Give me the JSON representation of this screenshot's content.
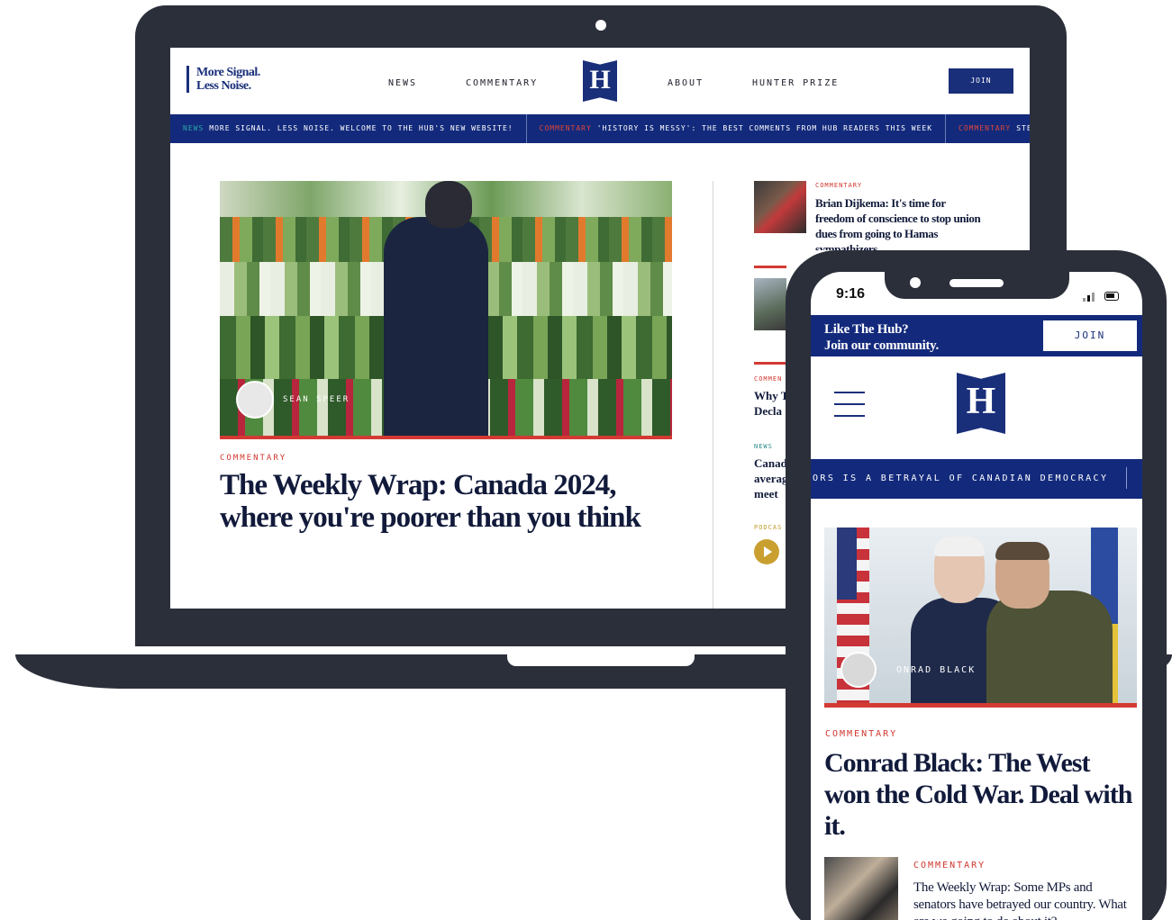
{
  "laptop": {
    "header": {
      "tagline_1": "More Signal.",
      "tagline_2": "Less Noise.",
      "nav": [
        "NEWS",
        "COMMENTARY",
        "ABOUT",
        "HUNTER PRIZE"
      ],
      "logo_letter": "H",
      "join_label": "JOIN"
    },
    "ticker": [
      {
        "tag": "NEWS",
        "text": "MORE SIGNAL. LESS NOISE. WELCOME TO THE HUB'S NEW WEBSITE!"
      },
      {
        "tag": "COMMENTARY",
        "text": "'HISTORY IS MESSY': THE BEST COMMENTS FROM HUB READERS THIS WEEK"
      },
      {
        "tag": "COMMENTARY",
        "text": "STEPHEN"
      }
    ],
    "hero": {
      "author": "SEAN SPEER",
      "category": "COMMENTARY",
      "headline": "The Weekly Wrap: Canada 2024, where you're poorer than you think"
    },
    "side": [
      {
        "category": "COMMENTARY",
        "headline": "Brian Dijkema: It's time for freedom of conscience to stop union dues from going to Hamas sympathizers"
      },
      {
        "category": "COMMEN",
        "headline_1": "Why T",
        "headline_2": "Decla"
      },
      {
        "category": "NEWS",
        "headline_1": "Canad",
        "headline_2": "averag",
        "headline_3": "meet"
      },
      {
        "category": "PODCAS"
      }
    ]
  },
  "phone": {
    "time": "9:16",
    "banner": {
      "line_1": "Like The Hub?",
      "line_2": "Join our community.",
      "join_label": "JOIN"
    },
    "logo_letter": "H",
    "ticker_text": "ORS IS A BETRAYAL OF CANADIAN DEMOCRACY",
    "hero": {
      "author": "ONRAD BLACK",
      "category": "COMMENTARY",
      "headline": "Conrad Black: The West won the Cold War. Deal with it."
    },
    "second": {
      "category": "COMMENTARY",
      "headline": "The Weekly Wrap: Some MPs and senators have betrayed our country. What are we going to do about it?"
    }
  },
  "colors": {
    "navy": "#1a2f7a",
    "red": "#d0352d",
    "device": "#2b2f3a"
  }
}
